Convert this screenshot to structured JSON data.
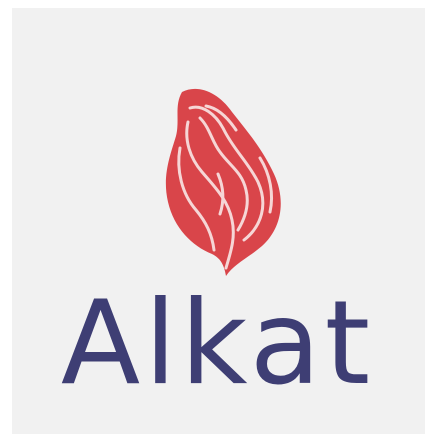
{
  "logo": {
    "brand_name": "Alkat",
    "emblem_icon": "red-leaf-emblem-icon",
    "colors": {
      "emblem": "#d9454a",
      "emblem_lines": "#f6d6d6",
      "wordmark": "#3e3e74",
      "background": "#f1f1f1"
    }
  }
}
